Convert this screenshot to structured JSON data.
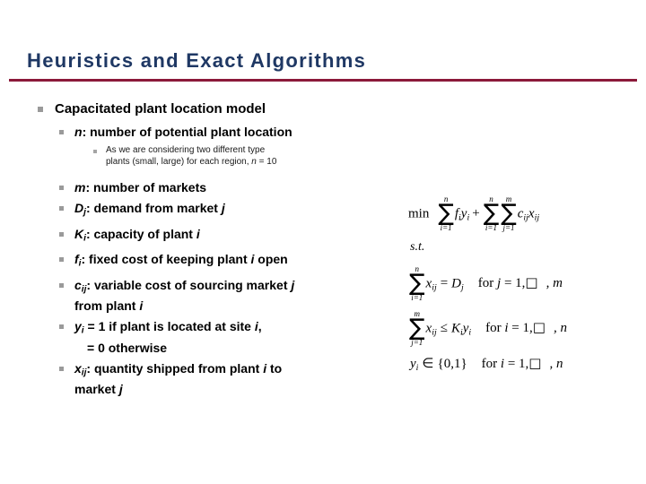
{
  "slide": {
    "title": "Heuristics and Exact Algorithms",
    "accent_navy": "#1F3864",
    "accent_maroon": "#8B1A3A",
    "bullet_gray": "#9A9A9A"
  },
  "outline": {
    "heading": "Capacitated plant location model",
    "items": [
      {
        "level": 2,
        "symbol": "n",
        "symbol_sub": "",
        "text": ": number of potential plant location"
      },
      {
        "level": 3,
        "line1": "As we are considering two different type",
        "line2_a": "plants (small, large) for each region, ",
        "line2_var": "n",
        "line2_b": " = 10"
      },
      {
        "level": 2,
        "symbol": "m",
        "symbol_sub": "",
        "text": ": number of markets"
      },
      {
        "level": 2,
        "symbol": "D",
        "symbol_sub": "j",
        "text": ": demand from market ",
        "trail_var": "j"
      },
      {
        "level": 2,
        "symbol": "K",
        "symbol_sub": "i",
        "text": ": capacity of plant ",
        "trail_var": "i"
      },
      {
        "level": 2,
        "symbol": "f",
        "symbol_sub": "i",
        "text": ": fixed cost of keeping plant ",
        "trail_var": "i",
        "trail_text": " open"
      },
      {
        "level": 2,
        "symbol": "c",
        "symbol_sub": "ij",
        "text": ": variable cost of sourcing market ",
        "trail_var": "j",
        "line2_text": "from plant ",
        "line2_var": "i"
      },
      {
        "level": 2,
        "symbol": "y",
        "symbol_sub": "i",
        "text": " = 1 if plant is located at site ",
        "trail_var": "i",
        "trail_text": ",",
        "line2_text": "=  0 otherwise"
      },
      {
        "level": 2,
        "symbol": "x",
        "symbol_sub": "ij",
        "text": ": quantity shipped from plant ",
        "trail_var": "i",
        "trail_text": " to",
        "line2_text": "market ",
        "line2_var": "j"
      }
    ]
  },
  "model": {
    "objective": {
      "min_label": "min",
      "sum1": {
        "upper": "n",
        "lower": "i=1"
      },
      "term1_a": "f",
      "term1_a_sub": "i",
      "term1_b": "y",
      "term1_b_sub": "i",
      "plus": "+",
      "sum2": {
        "upper": "n",
        "lower": "i=1"
      },
      "sum3": {
        "upper": "m",
        "lower": "j=1"
      },
      "term2_a": "c",
      "term2_a_sub": "ij",
      "term2_b": "x",
      "term2_b_sub": "ij"
    },
    "subject_to": "s.t.",
    "constraints": [
      {
        "sum": {
          "upper": "n",
          "lower": "i=1"
        },
        "lhs_var": "x",
        "lhs_sub": "ij",
        "relation": "=",
        "rhs_var": "D",
        "rhs_sub": "j",
        "qualifier_for": "for",
        "qualifier_var": "j",
        "qualifier_eq": "= 1,",
        "qualifier_box": "□",
        "qualifier_tail": ", m"
      },
      {
        "sum": {
          "upper": "m",
          "lower": "j=1"
        },
        "lhs_var": "x",
        "lhs_sub": "ij",
        "relation": "≤",
        "rhs_var": "K",
        "rhs_sub": "i",
        "rhs_var2": "y",
        "rhs_sub2": "i",
        "qualifier_for": "for",
        "qualifier_var": "i",
        "qualifier_eq": "= 1,",
        "qualifier_box": "□",
        "qualifier_tail": ", n"
      },
      {
        "lhs_var": "y",
        "lhs_sub": "i",
        "relation": "∈",
        "rhs_set": "{0,1}",
        "qualifier_for": "for",
        "qualifier_var": "i",
        "qualifier_eq": "= 1,",
        "qualifier_box": "□",
        "qualifier_tail": ", n"
      }
    ]
  }
}
